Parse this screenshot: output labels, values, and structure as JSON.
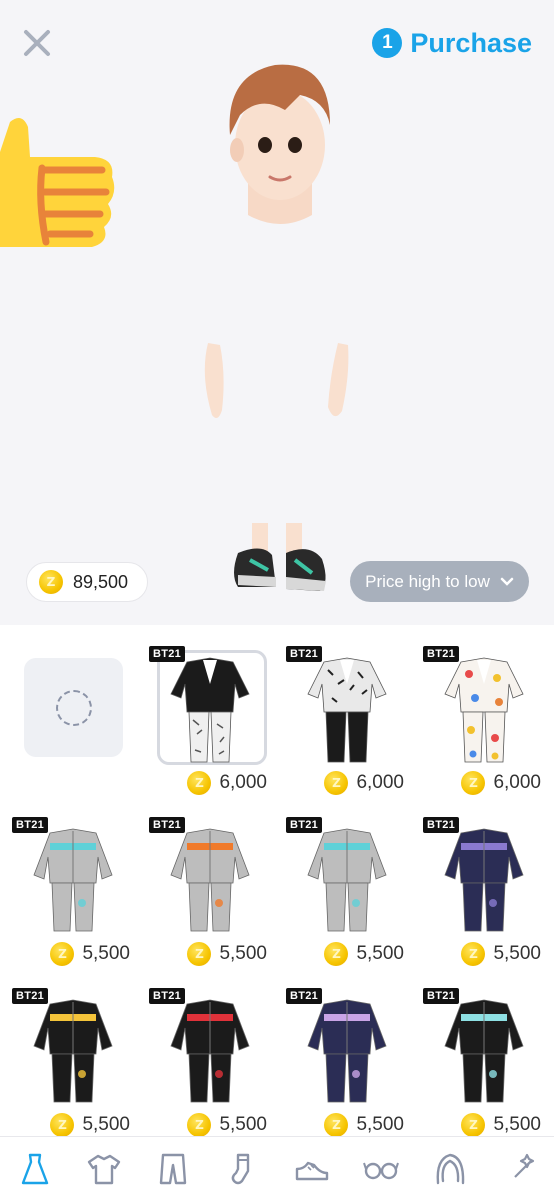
{
  "header": {
    "purchase_count": "1",
    "purchase_label": "Purchase"
  },
  "wallet": {
    "coin_glyph": "Z",
    "balance": "89,500"
  },
  "sort": {
    "label": "Price high to low"
  },
  "items": [
    {
      "badge": "BT21",
      "price": "6,000"
    },
    {
      "badge": "BT21",
      "price": "6,000"
    },
    {
      "badge": "BT21",
      "price": "6,000"
    },
    {
      "badge": "BT21",
      "price": "5,500"
    },
    {
      "badge": "BT21",
      "price": "5,500"
    },
    {
      "badge": "BT21",
      "price": "5,500"
    },
    {
      "badge": "BT21",
      "price": "5,500"
    },
    {
      "badge": "BT21",
      "price": "5,500"
    },
    {
      "badge": "BT21",
      "price": "5,500"
    },
    {
      "badge": "BT21",
      "price": "5,500"
    },
    {
      "badge": "BT21",
      "price": "5,500"
    }
  ],
  "tabs": [
    "dress-icon",
    "tshirt-icon",
    "pants-icon",
    "socks-icon",
    "shoe-icon",
    "glasses-icon",
    "hair-icon",
    "sparkle-icon"
  ],
  "colors": {
    "accent": "#1aa3e8",
    "sort_button": "#a8b0bc",
    "coin": "#f6c400",
    "active_tab": "#1aa3e8"
  }
}
